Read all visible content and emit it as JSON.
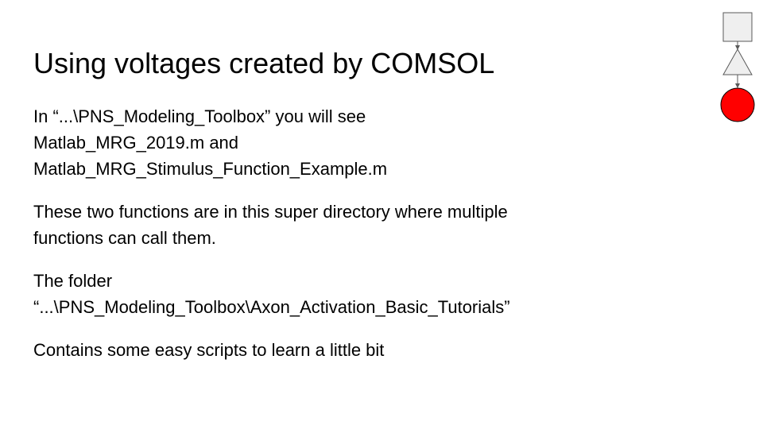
{
  "slide": {
    "title": "Using voltages created by COMSOL",
    "paragraphs": [
      {
        "lines": [
          "In “...\\PNS_Modeling_Toolbox” you will see",
          "Matlab_MRG_2019.m and",
          "Matlab_MRG_Stimulus_Function_Example.m"
        ]
      },
      {
        "lines": [
          "These two functions are in this super directory where multiple",
          "functions can call them."
        ]
      },
      {
        "lines": [
          "The folder",
          "“...\\PNS_Modeling_Toolbox\\Axon_Activation_Basic_Tutorials”"
        ]
      },
      {
        "lines": [
          "Contains some easy scripts to learn a little bit"
        ]
      }
    ]
  },
  "diagram": {
    "square_fill": "#efefef",
    "triangle_fill": "#efefef",
    "circle_fill": "#ff0000",
    "stroke": "#595959"
  }
}
